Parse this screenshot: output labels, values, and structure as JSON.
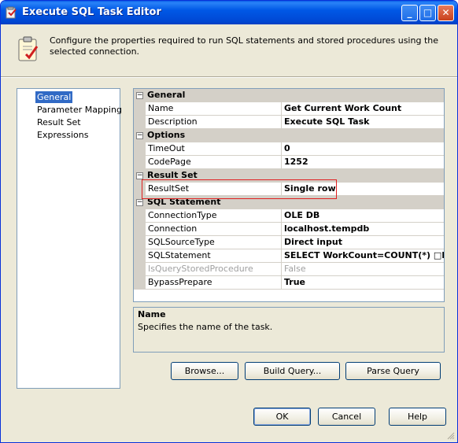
{
  "window": {
    "title": "Execute SQL Task Editor",
    "minimize_glyph": "_",
    "maximize_glyph": "□",
    "close_glyph": "✕"
  },
  "header": {
    "description": "Configure the properties required to run SQL statements and stored procedures using the selected connection."
  },
  "nav": {
    "items": [
      {
        "label": "General",
        "selected": true
      },
      {
        "label": "Parameter Mapping",
        "selected": false
      },
      {
        "label": "Result Set",
        "selected": false
      },
      {
        "label": "Expressions",
        "selected": false
      }
    ]
  },
  "grid": {
    "collapse_glyph": "−",
    "categories": {
      "general": {
        "label": "General",
        "properties": [
          {
            "name": "Name",
            "value": "Get Current Work Count"
          },
          {
            "name": "Description",
            "value": "Execute SQL Task"
          }
        ]
      },
      "options": {
        "label": "Options",
        "properties": [
          {
            "name": "TimeOut",
            "value": "0"
          },
          {
            "name": "CodePage",
            "value": "1252"
          }
        ]
      },
      "result_set": {
        "label": "Result Set",
        "properties": [
          {
            "name": "ResultSet",
            "value": "Single row"
          }
        ]
      },
      "sql_statement": {
        "label": "SQL Statement",
        "properties": [
          {
            "name": "ConnectionType",
            "value": "OLE DB"
          },
          {
            "name": "Connection",
            "value": "localhost.tempdb"
          },
          {
            "name": "SQLSourceType",
            "value": "Direct input"
          },
          {
            "name": "SQLStatement",
            "value": "SELECT WorkCount=COUNT(*) □FRO"
          },
          {
            "name": "IsQueryStoredProcedure",
            "value": "False"
          },
          {
            "name": "BypassPrepare",
            "value": "True"
          }
        ]
      }
    }
  },
  "description_panel": {
    "title": "Name",
    "text": "Specifies the name of the task."
  },
  "buttons": {
    "browse": "Browse...",
    "build_query": "Build Query...",
    "parse_query": "Parse Query",
    "ok": "OK",
    "cancel": "Cancel",
    "help": "Help"
  },
  "colors": {
    "titlebar": "#0058e6",
    "selection": "#316ac5",
    "highlight_box": "#e02020",
    "dialog_background": "#ece9d8"
  }
}
